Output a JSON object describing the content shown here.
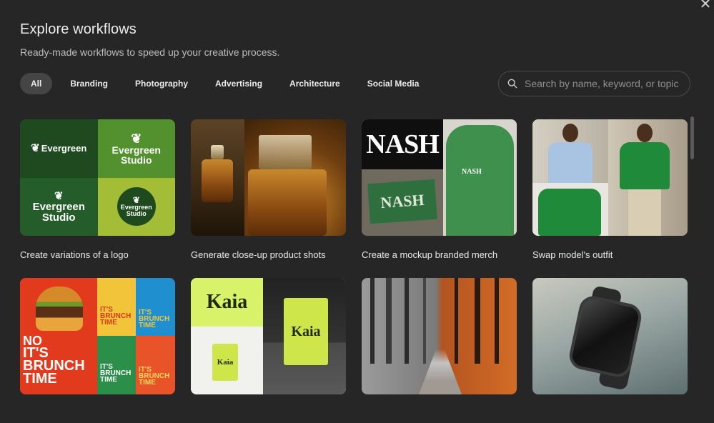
{
  "header": {
    "title": "Explore workflows",
    "subtitle": "Ready-made workflows to speed up your creative process."
  },
  "tabs": [
    {
      "label": "All",
      "active": true
    },
    {
      "label": "Branding",
      "active": false
    },
    {
      "label": "Photography",
      "active": false
    },
    {
      "label": "Advertising",
      "active": false
    },
    {
      "label": "Architecture",
      "active": false
    },
    {
      "label": "Social Media",
      "active": false
    }
  ],
  "search": {
    "placeholder": "Search by name, keyword, or topic",
    "value": ""
  },
  "cards": [
    {
      "title": "Create variations of a logo",
      "thumb": {
        "brand_a": "Evergreen",
        "brand_b": "Evergreen",
        "brand_b2": "Studio",
        "brand_c": "Evergreen",
        "brand_c2": "Studio",
        "brand_d": "Evergreen",
        "brand_d2": "Studio"
      }
    },
    {
      "title": "Generate close-up product shots"
    },
    {
      "title": "Create a mockup branded merch",
      "thumb": {
        "brand": "NASH"
      }
    },
    {
      "title": "Swap model's outfit"
    },
    {
      "title": "",
      "thumb": {
        "headline_1": "IT'S",
        "headline_2": "BRUNCH",
        "headline_3": "TIME",
        "headline_small": "NO"
      }
    },
    {
      "title": "",
      "thumb": {
        "brand": "Kaia"
      }
    },
    {
      "title": ""
    },
    {
      "title": ""
    }
  ],
  "icons": {
    "close": "close-icon",
    "search": "search-icon"
  },
  "colors": {
    "background": "#262626",
    "active_tab": "#454545",
    "text": "#e6e6e6",
    "muted": "#bdbdbd"
  }
}
